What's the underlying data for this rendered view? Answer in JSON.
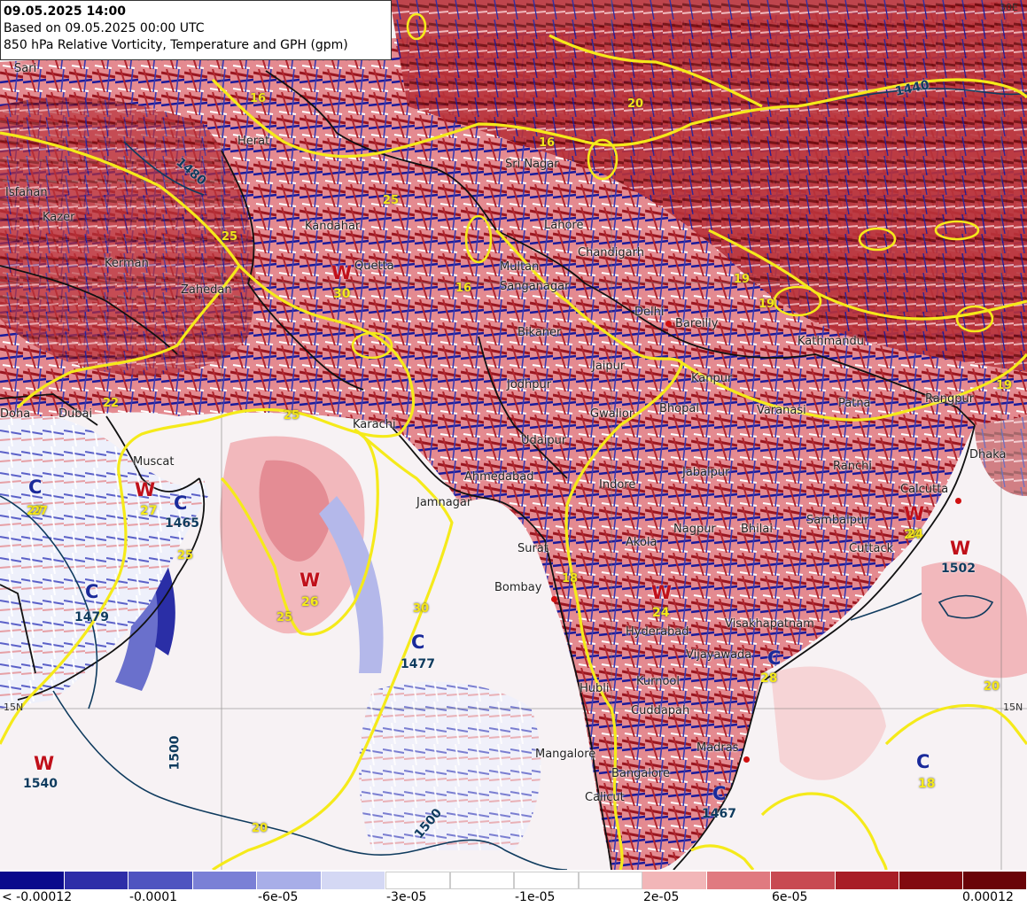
{
  "header": {
    "line1": "09.05.2025 14:00",
    "line2": "Based on 09.05.2025 00:00 UTC",
    "line3": "850 hPa Relative Vorticity, Temperature and GPH (gpm)"
  },
  "colors": {
    "strong_negative": "#0a0a8c",
    "negative": "#4c50c0",
    "weak_negative": "#aab0e6",
    "neutral": "#ffffff",
    "weak_positive": "#f0aeb0",
    "positive": "#c03a3e",
    "strong_positive": "#7a0a0a",
    "temperature_contour": "#f5ea1a",
    "gph_contour": "#0f3b5e",
    "border": "#111111"
  },
  "legend": {
    "colors": [
      "#0a0a8c",
      "#2e2ea8",
      "#4f54c0",
      "#7a80d6",
      "#a8aee8",
      "#d4d8f4",
      "#ffffff",
      "#ffffff",
      "#f2b6b8",
      "#e07a80",
      "#c84a52",
      "#a81e26",
      "#820a10"
    ],
    "labels": [
      "< -0.00012",
      "-0.0001",
      "-6e-05",
      "-3e-05",
      "-1e-05",
      "2e-05",
      "6e-05",
      "0.00012"
    ]
  },
  "cities": [
    "Sari",
    "Herat",
    "Kandahar",
    "Quetta",
    "Zahedan",
    "Isfahan",
    "Kazer",
    "Kerman",
    "Doha",
    "Dubai",
    "Muscat",
    "Karachi",
    "Multan",
    "Lahore",
    "Chandigarh",
    "Sri Nagar",
    "Delhi",
    "Bareilly",
    "Jaipur",
    "Jodhpur",
    "Ahmedabad",
    "Jamnagar",
    "Surat",
    "Bombay",
    "Indore",
    "Jabalpur",
    "Nagpur",
    "Bhilai",
    "Varanasi",
    "Patna",
    "Ranchi",
    "Calcutta",
    "Dhaka",
    "Rangpur",
    "Sambalpur",
    "Cuttack",
    "Hyderabad",
    "Visakhapatnam",
    "Vijayawada",
    "Hubli",
    "Kurnool",
    "Cuddapah",
    "Mangalore",
    "Bangalore",
    "Calicut",
    "Madras",
    "Kathmandu",
    "Udaipur",
    "Bikaner",
    "Akola",
    "Kanpur",
    "Bhopal",
    "Sanganagar",
    "Gwalior"
  ],
  "markers": [
    {
      "letter": "W",
      "value": "26"
    },
    {
      "letter": "W",
      "value": "27"
    },
    {
      "letter": "W",
      "value": "24"
    },
    {
      "letter": "W",
      "value": "24"
    },
    {
      "letter": "W",
      "value": "30"
    },
    {
      "letter": "W",
      "value": "1502"
    },
    {
      "letter": "W",
      "value": "1540"
    },
    {
      "letter": "C",
      "value": "1465"
    },
    {
      "letter": "C",
      "value": "1479"
    },
    {
      "letter": "C",
      "value": "1477"
    },
    {
      "letter": "C",
      "value": "1467"
    },
    {
      "letter": "C",
      "value": "18"
    },
    {
      "letter": "C",
      "value": "27"
    },
    {
      "letter": "C",
      "value": "28"
    }
  ],
  "gph_labels": [
    "1440",
    "1500",
    "1500",
    "1480"
  ],
  "temperature_labels": [
    "16",
    "16",
    "20",
    "25",
    "25",
    "22",
    "25",
    "25",
    "30",
    "19",
    "19",
    "19",
    "27",
    "25",
    "16",
    "18",
    "24",
    "20",
    "20"
  ],
  "lat_labels": [
    "15N",
    "15N",
    "30E"
  ]
}
